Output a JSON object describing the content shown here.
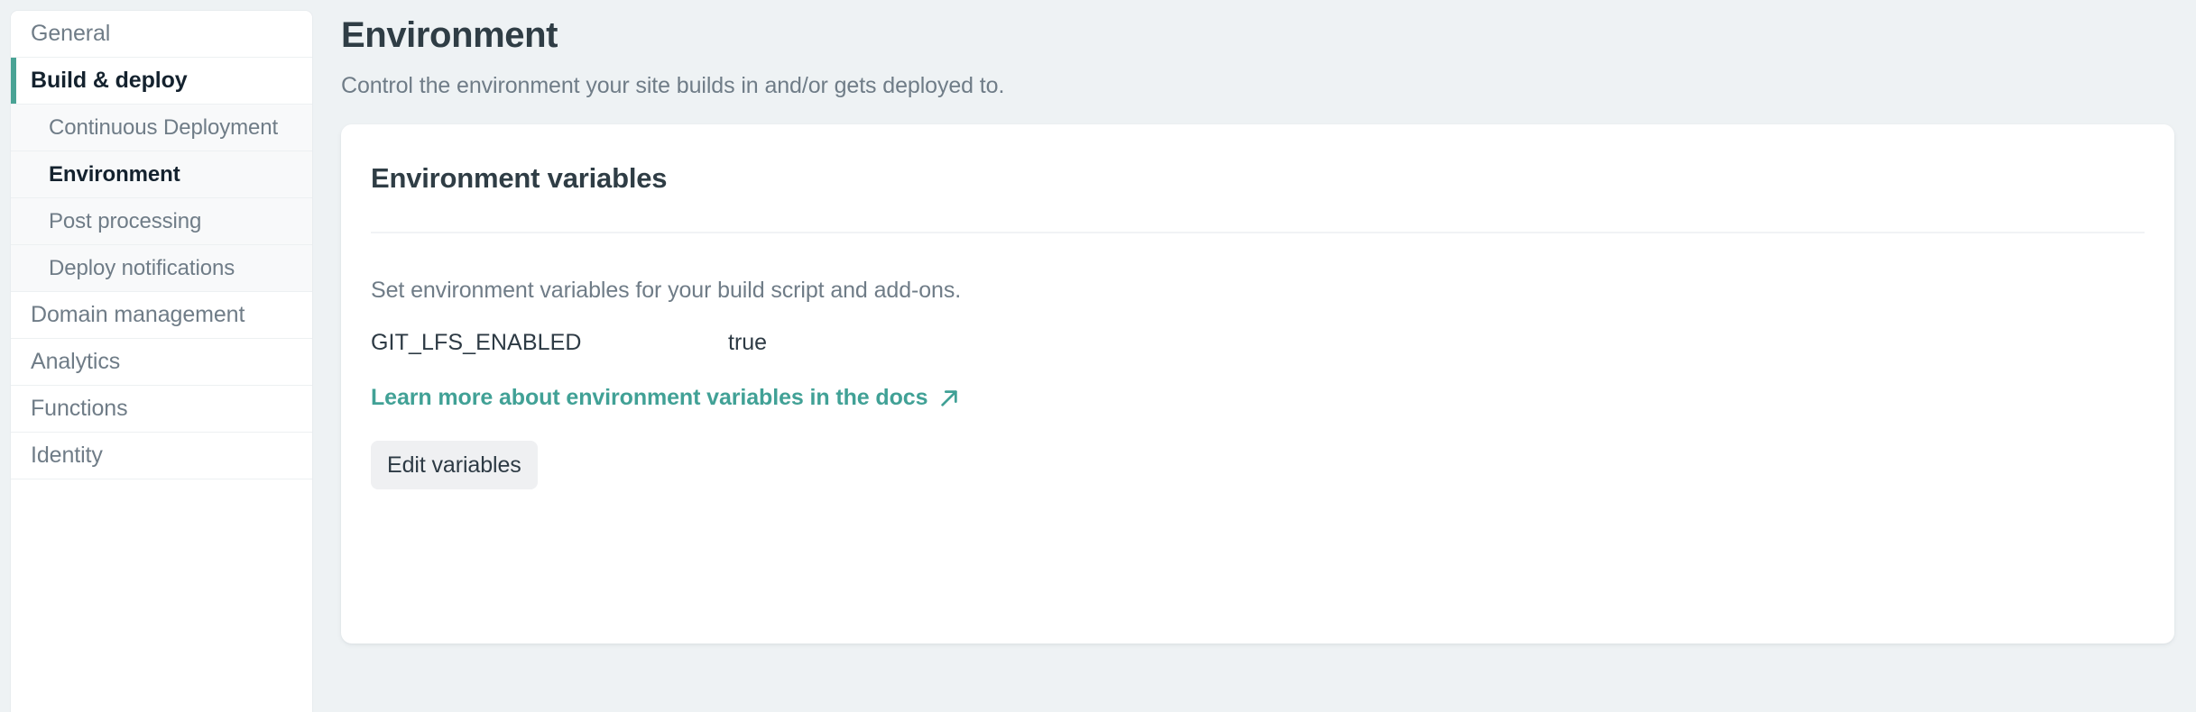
{
  "theme": {
    "page_bg": "#eef2f4",
    "card_bg": "#ffffff",
    "accent_teal": "#4aa395",
    "link_teal": "#41a196",
    "heading": "#2f3d45",
    "muted_text": "#6f7c87",
    "button_bg": "#eff0f2"
  },
  "sidebar": {
    "items": [
      {
        "label": "General",
        "level": "top",
        "state": "default"
      },
      {
        "label": "Build & deploy",
        "level": "top",
        "state": "active"
      },
      {
        "label": "Continuous Deployment",
        "level": "sub",
        "state": "default"
      },
      {
        "label": "Environment",
        "level": "sub",
        "state": "current"
      },
      {
        "label": "Post processing",
        "level": "sub",
        "state": "default"
      },
      {
        "label": "Deploy notifications",
        "level": "sub",
        "state": "default"
      },
      {
        "label": "Domain management",
        "level": "top",
        "state": "default"
      },
      {
        "label": "Analytics",
        "level": "top",
        "state": "default"
      },
      {
        "label": "Functions",
        "level": "top",
        "state": "default"
      },
      {
        "label": "Identity",
        "level": "top",
        "state": "default"
      }
    ]
  },
  "main": {
    "title": "Environment",
    "subtitle": "Control the environment your site builds in and/or gets deployed to.",
    "card": {
      "title": "Environment variables",
      "description": "Set environment variables for your build script and add-ons.",
      "variables": {
        "rows": [
          {
            "key": "GIT_LFS_ENABLED",
            "value": "true"
          }
        ]
      },
      "docs_link": {
        "label": "Learn more about environment variables in the docs",
        "icon": "external-link-arrow-icon"
      },
      "edit_button": "Edit variables"
    }
  }
}
